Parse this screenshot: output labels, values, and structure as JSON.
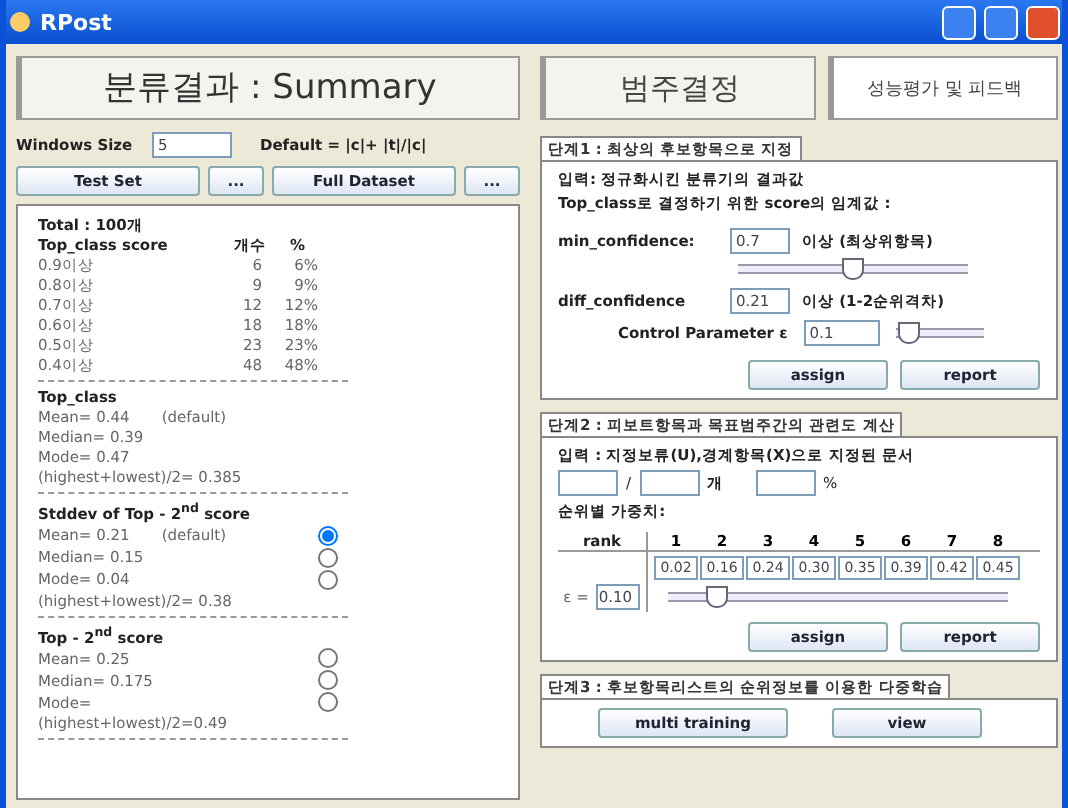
{
  "window": {
    "title": "RPost"
  },
  "left": {
    "header": "분류결과 : Summary",
    "window_size": {
      "label": "Windows Size",
      "value": "5",
      "default_text": "Default = |c|+ |t|/|c|"
    },
    "buttons": [
      {
        "label": "Test Set",
        "kind": "wide"
      },
      {
        "label": "...",
        "kind": "small"
      },
      {
        "label": "Full Dataset",
        "kind": "wide"
      },
      {
        "label": "...",
        "kind": "small"
      }
    ],
    "total": "Total : 100개",
    "score_table": {
      "columns": [
        "Top_class score",
        "개수",
        "%"
      ],
      "rows": [
        [
          "0.9이상",
          "6",
          "6%"
        ],
        [
          "0.8이상",
          "9",
          "9%"
        ],
        [
          "0.7이상",
          "12",
          "12%"
        ],
        [
          "0.6이상",
          "18",
          "18%"
        ],
        [
          "0.5이상",
          "23",
          "23%"
        ],
        [
          "0.4이상",
          "48",
          "48%"
        ]
      ]
    },
    "sections": [
      {
        "title": "Top_class",
        "lines": [
          {
            "text": "Mean= 0.44",
            "note": "(default)"
          },
          {
            "text": "Median= 0.39"
          },
          {
            "text": "Mode= 0.47"
          },
          {
            "text": "(highest+lowest)/2= 0.385"
          }
        ]
      },
      {
        "title": "Stddev of Top - 2$^{nd}$ score",
        "lines": [
          {
            "text": "Mean= 0.21",
            "note": "(default)",
            "selected": true
          },
          {
            "text": "Median= 0.15",
            "selected": false
          },
          {
            "text": "Mode= 0.04",
            "selected": false
          },
          {
            "text": "(highest+lowest)/2= 0.38"
          }
        ]
      },
      {
        "title": "Top - 2$^{nd}$ score",
        "lines": [
          {
            "text": "Mean= 0.25",
            "selected": false
          },
          {
            "text": "Median= 0.175",
            "selected": false
          },
          {
            "text": "Mode=",
            "selected": false
          },
          {
            "text": "(highest+lowest)/2=0.49"
          }
        ]
      }
    ]
  },
  "right": {
    "tabs": [
      {
        "label": "범주결정",
        "selected": true
      },
      {
        "label": "성능평가 및 피드백",
        "selected": false
      }
    ],
    "step1": {
      "title": "단계1 : 최상의 후보항목으로 지정",
      "desc": [
        "입력: 정규화시킨 분류기의 결과값",
        "Top_class로 결정하기 위한 score의 임계값 :"
      ],
      "min_confidence": {
        "label": "min_confidence:",
        "value": "0.7",
        "suffix": "이상 (최상위항목)",
        "level": 0.5
      },
      "diff_confidence": {
        "label": "diff_confidence",
        "value": "0.21",
        "suffix": "이상 (1-2순위격차)"
      },
      "control": {
        "label": "Control Parameter ε",
        "value": "0.1",
        "level": 0.05
      },
      "buttons": [
        "assign",
        "report"
      ]
    },
    "step2": {
      "title": "단계2 : 피보트항목과 목표범주간의 관련도 계산",
      "desc": "입력 : 지정보류(U),경계항목(X)으로 지정된 문서",
      "sep": "/",
      "unit1": "개",
      "unit2": "%",
      "weights_label": "순위별 가중치:",
      "rank_label": "rank",
      "ranks": [
        "1",
        "2",
        "3",
        "4",
        "5",
        "6",
        "7",
        "8"
      ],
      "weights": [
        "0.02",
        "0.16",
        "0.24",
        "0.30",
        "0.35",
        "0.39",
        "0.42",
        "0.45"
      ],
      "epsilon": {
        "label": "ε =",
        "value": "0.10",
        "level": 0.12
      },
      "buttons": [
        "assign",
        "report"
      ]
    },
    "step3": {
      "title": "단계3 : 후보항목리스트의 순위정보를 이용한 다중학습",
      "buttons": [
        "multi training",
        "view"
      ]
    }
  }
}
